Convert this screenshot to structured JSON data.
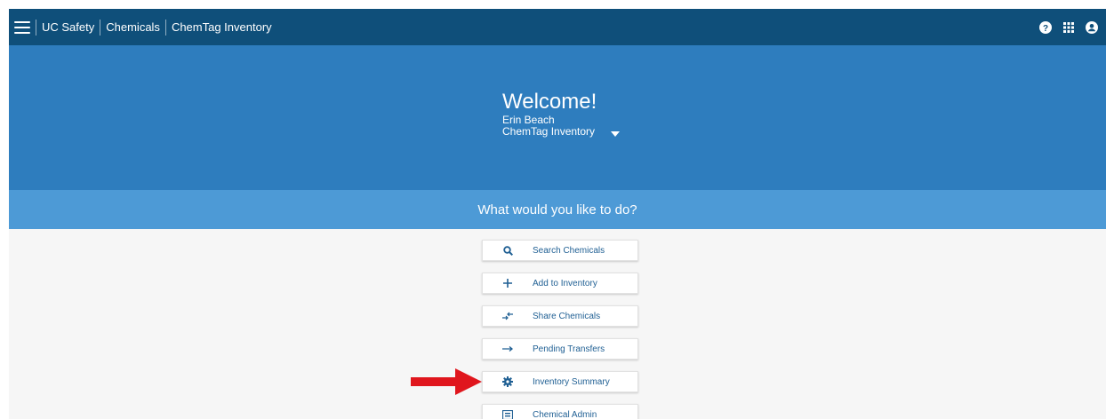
{
  "appbar": {
    "breadcrumbs": [
      "UC Safety",
      "Chemicals",
      "ChemTag Inventory"
    ],
    "icons": [
      "menu-icon",
      "help-icon",
      "apps-grid-icon",
      "account-icon"
    ]
  },
  "hero": {
    "title": "Welcome!",
    "user_name": "Erin Beach",
    "app_name": "ChemTag Inventory"
  },
  "prompt": {
    "question": "What would you like to do?"
  },
  "actions": [
    {
      "label": "Search Chemicals",
      "icon": "search-icon"
    },
    {
      "label": "Add to Inventory",
      "icon": "plus-icon"
    },
    {
      "label": "Share Chemicals",
      "icon": "share-arrows-icon"
    },
    {
      "label": "Pending Transfers",
      "icon": "right-arrow-icon"
    },
    {
      "label": "Inventory Summary",
      "icon": "gear-icon"
    },
    {
      "label": "Chemical Admin",
      "icon": "admin-card-icon"
    }
  ],
  "colors": {
    "appbar": "#0f4f7a",
    "hero": "#2e7dbe",
    "question_band": "#4d9ad6",
    "action_text": "#1f5f93",
    "annotation_arrow": "#e0161d"
  }
}
